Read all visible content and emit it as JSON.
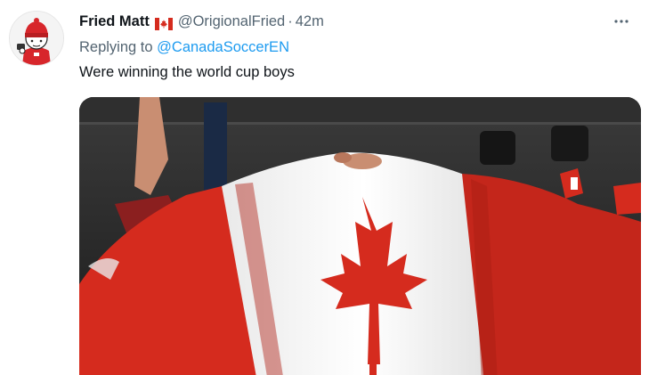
{
  "tweet": {
    "display_name": "Fried Matt",
    "name_flag_icon": "canada-flag-emoji",
    "handle": "@OrigionalFried",
    "separator": "·",
    "timestamp": "42m",
    "more_icon": "more-horizontal-icon",
    "reply": {
      "prefix": "Replying to",
      "handle": "@CanadaSoccerEN"
    },
    "text": "Were winning the world cup boys",
    "media": {
      "type": "gif",
      "subject": "canada-flag"
    }
  },
  "colors": {
    "text_primary": "#0f1419",
    "text_secondary": "#536471",
    "link": "#1d9bf0",
    "flag_red": "#d52b1e",
    "flag_white": "#ffffff"
  }
}
